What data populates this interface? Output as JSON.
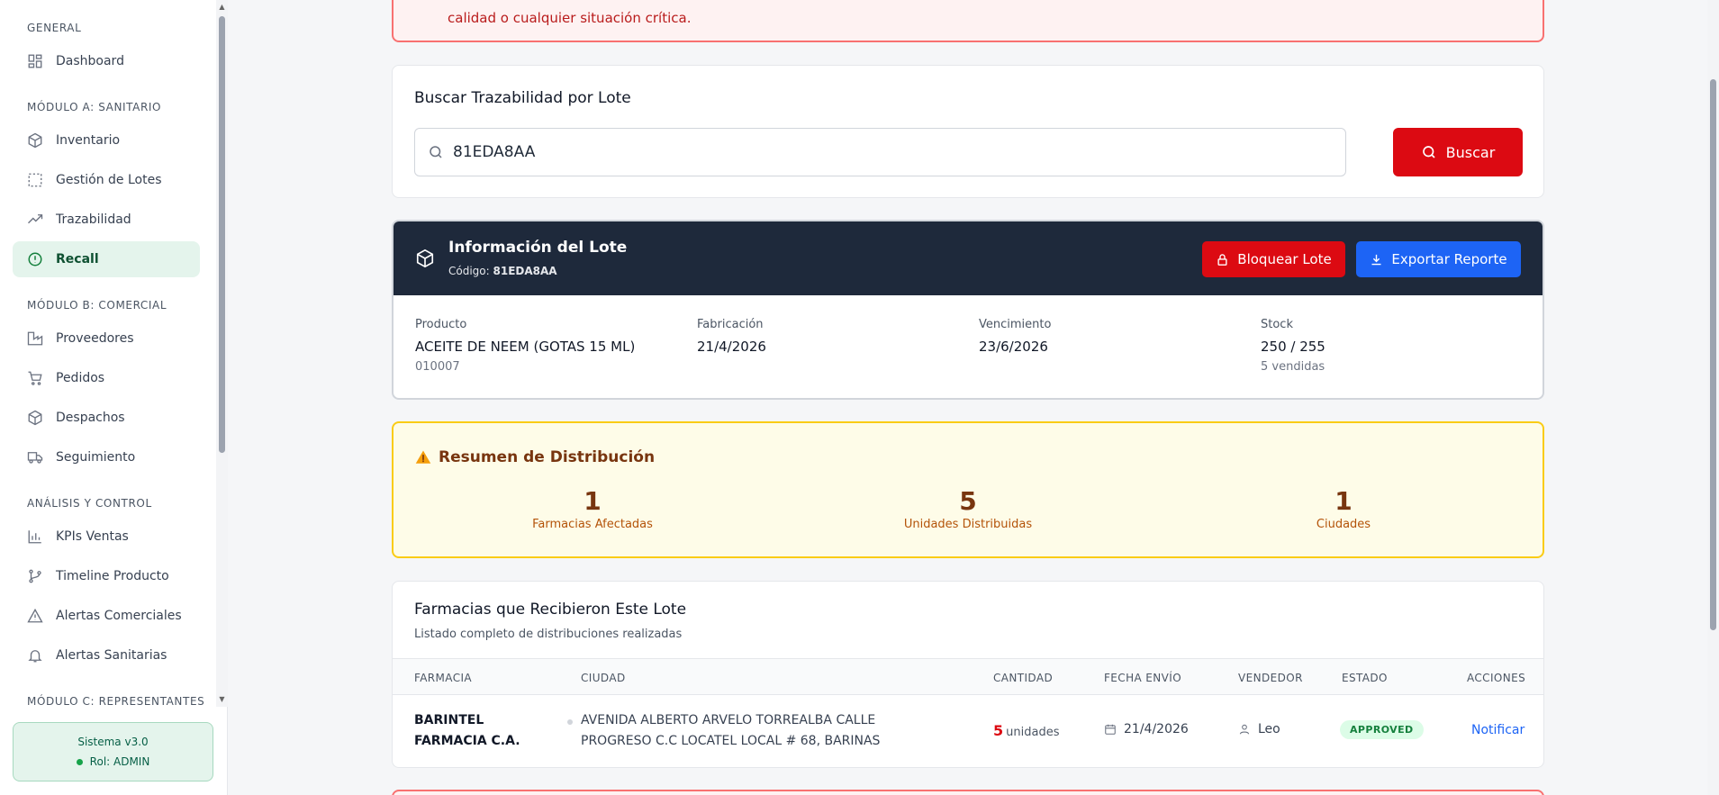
{
  "sidebar": {
    "sections": [
      {
        "label": "GENERAL"
      },
      {
        "label": "MÓDULO A: SANITARIO"
      },
      {
        "label": "MÓDULO B: COMERCIAL"
      },
      {
        "label": "ANÁLISIS Y CONTROL"
      },
      {
        "label": "MÓDULO C: REPRESENTANTES"
      }
    ],
    "items": [
      {
        "label": "Dashboard",
        "icon": "dashboard-icon"
      },
      {
        "label": "Inventario",
        "icon": "box-icon"
      },
      {
        "label": "Gestión de Lotes",
        "icon": "dashed-square-icon"
      },
      {
        "label": "Trazabilidad",
        "icon": "trending-up-icon"
      },
      {
        "label": "Recall",
        "icon": "alert-circle-icon",
        "active": true
      },
      {
        "label": "Proveedores",
        "icon": "factory-icon"
      },
      {
        "label": "Pedidos",
        "icon": "cart-icon"
      },
      {
        "label": "Despachos",
        "icon": "box-icon"
      },
      {
        "label": "Seguimiento",
        "icon": "truck-icon"
      },
      {
        "label": "KPIs Ventas",
        "icon": "bar-chart-icon"
      },
      {
        "label": "Timeline Producto",
        "icon": "git-branch-icon"
      },
      {
        "label": "Alertas Comerciales",
        "icon": "warning-triangle-icon"
      },
      {
        "label": "Alertas Sanitarias",
        "icon": "bell-icon"
      }
    ],
    "system": {
      "version": "Sistema v3.0",
      "role": "Rol: ADMIN"
    }
  },
  "alert": {
    "text": "calidad o cualquier situación crítica."
  },
  "search": {
    "title": "Buscar Trazabilidad por Lote",
    "value": "81EDA8AA",
    "button_label": "Buscar"
  },
  "lot": {
    "title": "Información del Lote",
    "code_label": "Código:",
    "code": "81EDA8AA",
    "block_label": "Bloquear Lote",
    "export_label": "Exportar Reporte",
    "fields": {
      "product": {
        "label": "Producto",
        "value": "ACEITE DE NEEM (GOTAS 15 ML)",
        "sub": "010007"
      },
      "manufacture": {
        "label": "Fabricación",
        "value": "21/4/2026"
      },
      "expiry": {
        "label": "Vencimiento",
        "value": "23/6/2026"
      },
      "stock": {
        "label": "Stock",
        "value": "250 / 255",
        "sub": "5 vendidas"
      }
    }
  },
  "distribution": {
    "title": "Resumen de Distribución",
    "stats": [
      {
        "value": "1",
        "label": "Farmacias Afectadas"
      },
      {
        "value": "5",
        "label": "Unidades Distribuidas"
      },
      {
        "value": "1",
        "label": "Ciudades"
      }
    ]
  },
  "table": {
    "title": "Farmacias que Recibieron Este Lote",
    "subtitle": "Listado completo de distribuciones realizadas",
    "headers": [
      "FARMACIA",
      "CIUDAD",
      "CANTIDAD",
      "FECHA ENVÍO",
      "VENDEDOR",
      "ESTADO",
      "ACCIONES"
    ],
    "rows": [
      {
        "pharmacy": "BARINTEL FARMACIA C.A.",
        "city": "AVENIDA ALBERTO ARVELO TORREALBA CALLE PROGRESO C.C LOCATEL LOCAL # 68, BARINAS",
        "qty": "5",
        "qty_unit": "unidades",
        "date": "21/4/2026",
        "seller": "Leo",
        "status": "APPROVED",
        "action": "Notificar"
      }
    ]
  },
  "colors": {
    "accent_red": "#dc0a12",
    "accent_blue": "#1d64f5",
    "active_green": "#e4f4ec",
    "header_dark": "#1e293b"
  }
}
